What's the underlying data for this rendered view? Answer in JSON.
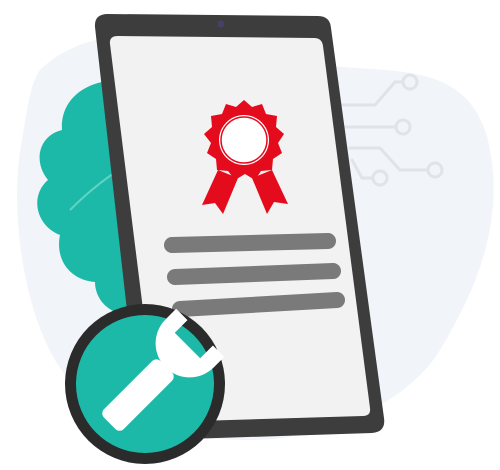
{
  "illustration": {
    "icons": [
      "background-blob",
      "leaf-icon",
      "circuit-lines-icon",
      "tablet",
      "camera-dot",
      "award-ribbon-icon",
      "text-line-placeholder",
      "wrench-icon"
    ],
    "colors": {
      "background_blob": "#f1f4f8",
      "leaf": "#1cb9a8",
      "leaf_vein": "#5fd3c5",
      "circuit": "#dfe4ea",
      "tablet_frame": "#3d3d3d",
      "screen": "#f2f2f2",
      "camera": "#4a3f6b",
      "ribbon_red": "#e30b1c",
      "ribbon_inner": "#ffffff",
      "text_lines": "#7a7a7a",
      "badge_teal": "#1cb9a8",
      "badge_ring": "#2b2b2b",
      "wrench": "#ffffff"
    }
  }
}
